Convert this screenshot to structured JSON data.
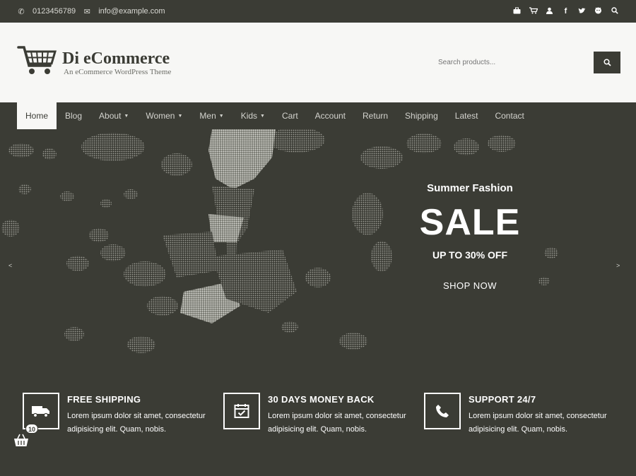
{
  "topbar": {
    "phone": "0123456789",
    "email": "info@example.com",
    "social_icons": [
      "briefcase-icon",
      "cart-icon",
      "user-icon",
      "facebook-icon",
      "twitter-icon",
      "github-icon",
      "search-icon"
    ]
  },
  "header": {
    "site_title": "Di eCommerce",
    "tagline": "An eCommerce WordPress Theme",
    "search_placeholder": "Search products..."
  },
  "nav": {
    "items": [
      {
        "label": "Home",
        "active": true
      },
      {
        "label": "Blog"
      },
      {
        "label": "About",
        "caret": true
      },
      {
        "label": "Women",
        "caret": true
      },
      {
        "label": "Men",
        "caret": true
      },
      {
        "label": "Kids",
        "caret": true
      },
      {
        "label": "Cart"
      },
      {
        "label": "Account"
      },
      {
        "label": "Return"
      },
      {
        "label": "Shipping"
      },
      {
        "label": "Latest"
      },
      {
        "label": "Contact"
      }
    ]
  },
  "hero": {
    "kicker": "Summer Fashion",
    "headline": "SALE",
    "offer": "UP TO 30% OFF",
    "cta": "SHOP NOW"
  },
  "features": [
    {
      "title": "FREE SHIPPING",
      "text": "Lorem ipsum dolor sit amet, consectetur adipisicing elit. Quam, nobis.",
      "icon": "truck-icon"
    },
    {
      "title": "30 DAYS MONEY BACK",
      "text": "Lorem ipsum dolor sit amet, consectetur adipisicing elit. Quam, nobis.",
      "icon": "calendar-check-icon"
    },
    {
      "title": "SUPPORT 24/7",
      "text": "Lorem ipsum dolor sit amet, consectetur adipisicing elit. Quam, nobis.",
      "icon": "phone-icon"
    }
  ],
  "cart_widget": {
    "count": "10"
  },
  "colors": {
    "dark": "#3b3c35",
    "light": "#f7f7f5"
  }
}
